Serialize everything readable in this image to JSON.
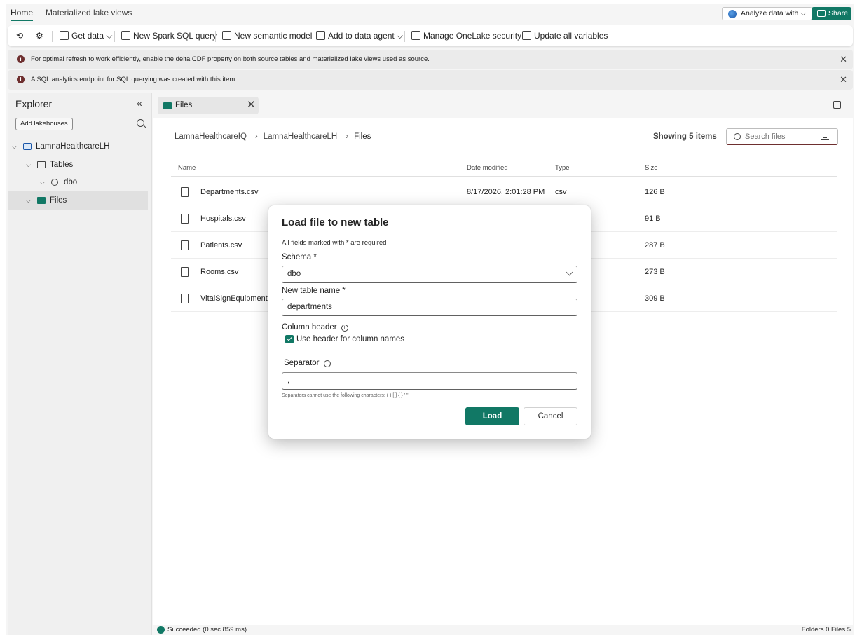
{
  "top_tabs": [
    "Home",
    "Materialized lake views"
  ],
  "topbar": {
    "analyze_label": "Analyze data with",
    "share_label": "Share"
  },
  "toolbar": {
    "get_data": "Get data",
    "new_spark_sql": "New Spark SQL query",
    "new_semantic_model": "New semantic model",
    "add_to_data_agent": "Add to data agent",
    "manage_onelake_security": "Manage OneLake security",
    "update_all_variables": "Update all variables"
  },
  "messages": [
    "For optimal refresh to work efficiently, enable the delta CDF property on both source tables and materialized lake views used as source.",
    "A SQL analytics endpoint for SQL querying was created with this item."
  ],
  "explorer": {
    "title": "Explorer",
    "add_lakehouses": "Add lakehouses",
    "lakehouse": "LamnaHealthcareLH",
    "tables": "Tables",
    "schema": "dbo",
    "files": "Files"
  },
  "main": {
    "tab_label": "Files",
    "breadcrumb": [
      "LamnaHealthcareIQ",
      "LamnaHealthcareLH",
      "Files"
    ],
    "count": "Showing 5 items",
    "search_placeholder": "Search files",
    "columns": {
      "name": "Name",
      "date": "Date modified",
      "type": "Type",
      "size": "Size"
    },
    "files": [
      {
        "name": "Departments.csv",
        "date": "8/17/2026, 2:01:28 PM",
        "type": "csv",
        "size": "126 B"
      },
      {
        "name": "Hospitals.csv",
        "date": "",
        "type": "",
        "size": "91 B"
      },
      {
        "name": "Patients.csv",
        "date": "",
        "type": "",
        "size": "287 B"
      },
      {
        "name": "Rooms.csv",
        "date": "",
        "type": "",
        "size": "273 B"
      },
      {
        "name": "VitalSignEquipment.",
        "date": "",
        "type": "",
        "size": "309 B"
      }
    ]
  },
  "status": {
    "left": "Succeeded (0 sec 859 ms)",
    "right": "Folders 0 Files 5"
  },
  "dialog": {
    "title": "Load file to new table",
    "required_note": "All fields marked with * are required",
    "schema_label": "Schema *",
    "schema_value": "dbo",
    "table_name_label": "New table name *",
    "table_name_value": "departments",
    "column_header_label": "Column header",
    "use_header_label": "Use header for column names",
    "separator_label": "Separator",
    "separator_value": ",",
    "separator_hint": "Separators cannot use the following characters: ( ) [ ] { } ' \"",
    "load_label": "Load",
    "cancel_label": "Cancel"
  },
  "colors": {
    "accent": "#117865",
    "info": "#6e2f2f"
  }
}
